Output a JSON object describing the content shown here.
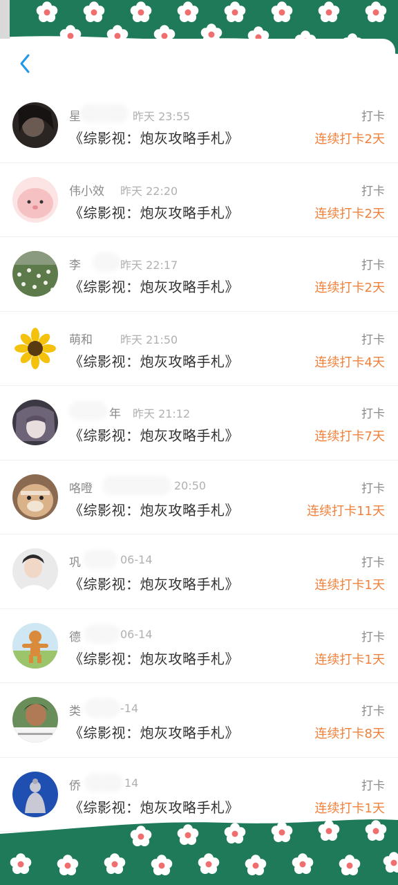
{
  "header": {
    "back_icon": "chevron-left-icon"
  },
  "colors": {
    "frame_green": "#1f7a5a",
    "accent_orange": "#f0803a",
    "back_blue": "#2196e6"
  },
  "checkins": [
    {
      "name": "星",
      "time": "昨天 23:55",
      "book": "《综影视：炮灰攻略手札》",
      "tag": "打卡",
      "streak": "连续打卡2天"
    },
    {
      "name": "伟小效",
      "time": "昨天 22:20",
      "book": "《综影视：炮灰攻略手札》",
      "tag": "打卡",
      "streak": "连续打卡2天"
    },
    {
      "name": "李",
      "time": "昨天 22:17",
      "book": "《综影视：炮灰攻略手札》",
      "tag": "打卡",
      "streak": "连续打卡2天"
    },
    {
      "name": "萌和",
      "time": "昨天 21:50",
      "book": "《综影视：炮灰攻略手札》",
      "tag": "打卡",
      "streak": "连续打卡4天"
    },
    {
      "name": "年",
      "time": "昨天 21:12",
      "book": "《综影视：炮灰攻略手札》",
      "tag": "打卡",
      "streak": "连续打卡7天"
    },
    {
      "name": "咯噔",
      "time": "20:50",
      "book": "《综影视：炮灰攻略手札》",
      "tag": "打卡",
      "streak": "连续打卡11天"
    },
    {
      "name": "巩",
      "time": "06-14",
      "book": "《综影视：炮灰攻略手札》",
      "tag": "打卡",
      "streak": "连续打卡1天"
    },
    {
      "name": "德",
      "time": "06-14",
      "book": "《综影视：炮灰攻略手札》",
      "tag": "打卡",
      "streak": "连续打卡1天"
    },
    {
      "name": "类",
      "time": "-14",
      "book": "《综影视：炮灰攻略手札》",
      "tag": "打卡",
      "streak": "连续打卡8天"
    },
    {
      "name": "侨",
      "time": "14",
      "book": "《综影视：炮灰攻略手札》",
      "tag": "打卡",
      "streak": "连续打卡1天"
    }
  ]
}
